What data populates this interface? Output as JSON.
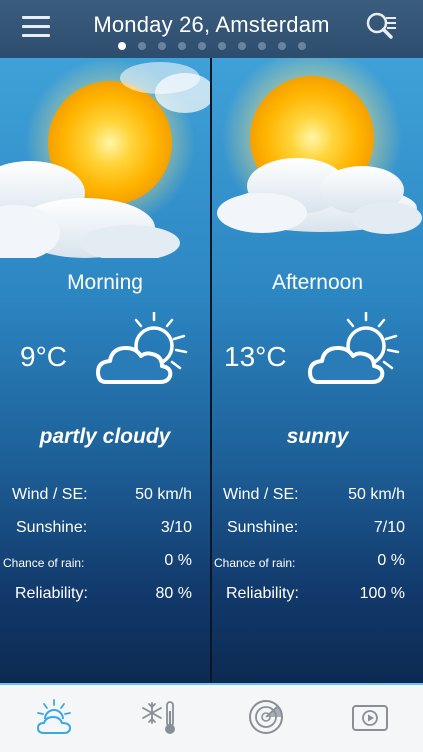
{
  "header": {
    "title": "Monday 26, Amsterdam",
    "page_count": 10,
    "active_page": 1
  },
  "icons": {
    "menu": "hamburger-menu-icon",
    "search": "search-list-icon",
    "weather": "partly-cloudy-icon",
    "tabs": [
      "weather-tab-icon",
      "snow-thermometer-icon",
      "radar-icon",
      "video-play-icon"
    ]
  },
  "colors": {
    "header": "#34567a",
    "panel_top": "#3fa1d8",
    "panel_bottom": "#0c2a52",
    "sun": "#ffc21a",
    "tab_active": "#39a9e0",
    "tab_inactive": "#8a8f96"
  },
  "panels": [
    {
      "period": "Morning",
      "temperature": "9°C",
      "condition": "partly cloudy",
      "rows": [
        {
          "label": "Wind / SE:",
          "value": "50 km/h"
        },
        {
          "label": "Sunshine:",
          "value": "3/10"
        },
        {
          "label": "Chance of rain:",
          "value": "0 %"
        },
        {
          "label": "Reliability:",
          "value": "80 %"
        }
      ]
    },
    {
      "period": "Afternoon",
      "temperature": "13°C",
      "condition": "sunny",
      "rows": [
        {
          "label": "Wind / SE:",
          "value": "50 km/h"
        },
        {
          "label": "Sunshine:",
          "value": "7/10"
        },
        {
          "label": "Chance of rain:",
          "value": "0 %"
        },
        {
          "label": "Reliability:",
          "value": "100 %"
        }
      ]
    }
  ]
}
